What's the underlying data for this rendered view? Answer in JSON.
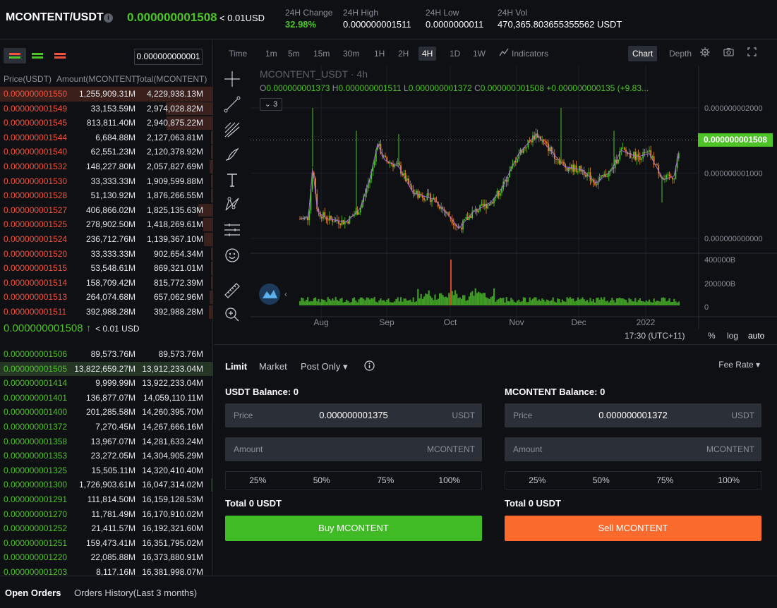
{
  "header": {
    "pair": "MCONTENT/USDT",
    "last_price": "0.000000001508",
    "last_usd": "< 0.01USD",
    "stats": [
      {
        "label": "24H Change",
        "value": "32.98%"
      },
      {
        "label": "24H High",
        "value": "0.000000001511"
      },
      {
        "label": "24H Low",
        "value": "0.0000000011"
      },
      {
        "label": "24H Vol",
        "value": "470,365.803655355562 USDT"
      }
    ]
  },
  "orderbook": {
    "precision": "0.000000000001",
    "headers": {
      "price": "Price(USDT)",
      "amount": "Amount(MCONTENT)",
      "total": "Total(MCONTENT)"
    },
    "asks": [
      {
        "price": "0.000000001550",
        "amount": "1,255,909.31M",
        "total": "4,229,938.13M",
        "depth": 1.0
      },
      {
        "price": "0.000000001549",
        "amount": "33,153.59M",
        "total": "2,974,028.82M",
        "depth": 0.7
      },
      {
        "price": "0.000000001545",
        "amount": "813,811.40M",
        "total": "2,940,875.22M",
        "depth": 0.69
      },
      {
        "price": "0.000000001544",
        "amount": "6,684.88M",
        "total": "2,127,063.81M",
        "depth": 0.03
      },
      {
        "price": "0.000000001540",
        "amount": "62,551.23M",
        "total": "2,120,378.92M",
        "depth": 0.03
      },
      {
        "price": "0.000000001532",
        "amount": "148,227.80M",
        "total": "2,057,827.69M",
        "depth": 0.05
      },
      {
        "price": "0.000000001530",
        "amount": "33,333.33M",
        "total": "1,909,599.88M",
        "depth": 0.03
      },
      {
        "price": "0.000000001528",
        "amount": "51,130.92M",
        "total": "1,876,266.55M",
        "depth": 0.03
      },
      {
        "price": "0.000000001527",
        "amount": "406,866.02M",
        "total": "1,825,135.63M",
        "depth": 0.22
      },
      {
        "price": "0.000000001525",
        "amount": "278,902.50M",
        "total": "1,418,269.61M",
        "depth": 0.15
      },
      {
        "price": "0.000000001524",
        "amount": "236,712.76M",
        "total": "1,139,367.10M",
        "depth": 0.14
      },
      {
        "price": "0.000000001520",
        "amount": "33,333.33M",
        "total": "902,654.34M",
        "depth": 0.03
      },
      {
        "price": "0.000000001515",
        "amount": "53,548.61M",
        "total": "869,321.01M",
        "depth": 0.03
      },
      {
        "price": "0.000000001514",
        "amount": "158,709.42M",
        "total": "815,772.39M",
        "depth": 0.03
      },
      {
        "price": "0.000000001513",
        "amount": "264,074.68M",
        "total": "657,062.96M",
        "depth": 0.05
      },
      {
        "price": "0.000000001511",
        "amount": "392,988.28M",
        "total": "392,988.28M",
        "depth": 0.06
      }
    ],
    "mid_price": "0.000000001508",
    "mid_arrow": "↑",
    "mid_usd": "< 0.01 USD",
    "bids": [
      {
        "price": "0.000000001506",
        "amount": "89,573.76M",
        "total": "89,573.76M",
        "depth": 0.01
      },
      {
        "price": "0.000000001505",
        "amount": "13,822,659.27M",
        "total": "13,912,233.04M",
        "depth": 0.0
      },
      {
        "price": "0.000000001414",
        "amount": "9,999.99M",
        "total": "13,922,233.04M",
        "depth": 0.0
      },
      {
        "price": "0.000000001401",
        "amount": "136,877.07M",
        "total": "14,059,110.11M",
        "depth": 0.01
      },
      {
        "price": "0.000000001400",
        "amount": "201,285.58M",
        "total": "14,260,395.70M",
        "depth": 0.015
      },
      {
        "price": "0.000000001372",
        "amount": "7,270.45M",
        "total": "14,267,666.16M",
        "depth": 0.005
      },
      {
        "price": "0.000000001358",
        "amount": "13,967.07M",
        "total": "14,281,633.24M",
        "depth": 0.005
      },
      {
        "price": "0.000000001353",
        "amount": "23,272.05M",
        "total": "14,304,905.29M",
        "depth": 0.005
      },
      {
        "price": "0.000000001325",
        "amount": "15,505.11M",
        "total": "14,320,410.40M",
        "depth": 0.005
      },
      {
        "price": "0.000000001300",
        "amount": "1,726,903.61M",
        "total": "16,047,314.02M",
        "depth": 0.03
      },
      {
        "price": "0.000000001291",
        "amount": "111,814.50M",
        "total": "16,159,128.53M",
        "depth": 0.005
      },
      {
        "price": "0.000000001270",
        "amount": "11,781.49M",
        "total": "16,170,910.02M",
        "depth": 0.005
      },
      {
        "price": "0.000000001252",
        "amount": "21,411.57M",
        "total": "16,192,321.60M",
        "depth": 0.005
      },
      {
        "price": "0.000000001251",
        "amount": "159,473.41M",
        "total": "16,351,795.02M",
        "depth": 0.005
      },
      {
        "price": "0.000000001220",
        "amount": "22,085.88M",
        "total": "16,373,880.91M",
        "depth": 0.005
      },
      {
        "price": "0.000000001203",
        "amount": "8,117.16M",
        "total": "16,381,998.07M",
        "depth": 0.005
      }
    ]
  },
  "chart_toolbar": {
    "timeframes": [
      "Time",
      "1m",
      "5m",
      "15m",
      "30m",
      "1H",
      "2H",
      "4H",
      "1D",
      "1W"
    ],
    "active_timeframe": "4H",
    "indicators": "Indicators",
    "chart": "Chart",
    "depth": "Depth"
  },
  "chart_data": {
    "type": "candlestick",
    "title": "MCONTENT_USDT · 4h",
    "ohlc": {
      "O": "0.000000001373",
      "H": "0.000000001511",
      "L": "0.000000001372",
      "C": "0.000000001508",
      "change": "+0.000000000135 (+9.83..."
    },
    "indicator_count": "3",
    "price_axis": [
      "0.000000002000",
      "0.000000001000",
      "0.000000000000"
    ],
    "volume_axis": [
      "400000B",
      "200000B",
      "0"
    ],
    "x_ticks": [
      "Aug",
      "Sep",
      "Oct",
      "Nov",
      "Dec",
      "2022"
    ],
    "last_price": "0.000000001508",
    "timezone": "17:30 (UTC+11)",
    "scale_options": [
      "%",
      "log",
      "auto"
    ],
    "colors": {
      "up": "#4ec327",
      "down": "#f0852d",
      "ma": "#a56ad6"
    }
  },
  "trade": {
    "tabs": [
      "Limit",
      "Market",
      "Post Only"
    ],
    "fee_rate": "Fee Rate",
    "buy": {
      "balance": "USDT Balance: 0",
      "price_label": "Price",
      "price": "0.000000001375",
      "price_unit": "USDT",
      "amount_label": "Amount",
      "amount_unit": "MCONTENT",
      "percents": [
        "25%",
        "50%",
        "75%",
        "100%"
      ],
      "total": "Total 0 USDT",
      "button": "Buy MCONTENT"
    },
    "sell": {
      "balance": "MCONTENT Balance: 0",
      "price_label": "Price",
      "price": "0.000000001372",
      "price_unit": "USDT",
      "amount_label": "Amount",
      "amount_unit": "MCONTENT",
      "percents": [
        "25%",
        "50%",
        "75%",
        "100%"
      ],
      "total": "Total 0 USDT",
      "button": "Sell MCONTENT"
    }
  },
  "bottom_tabs": [
    "Open Orders",
    "Orders History(Last 3 months)"
  ],
  "colors": {
    "green": "#4ec327",
    "red": "#f5533d",
    "sell_button": "#fa6a2c",
    "buy_button": "#40bb26"
  }
}
